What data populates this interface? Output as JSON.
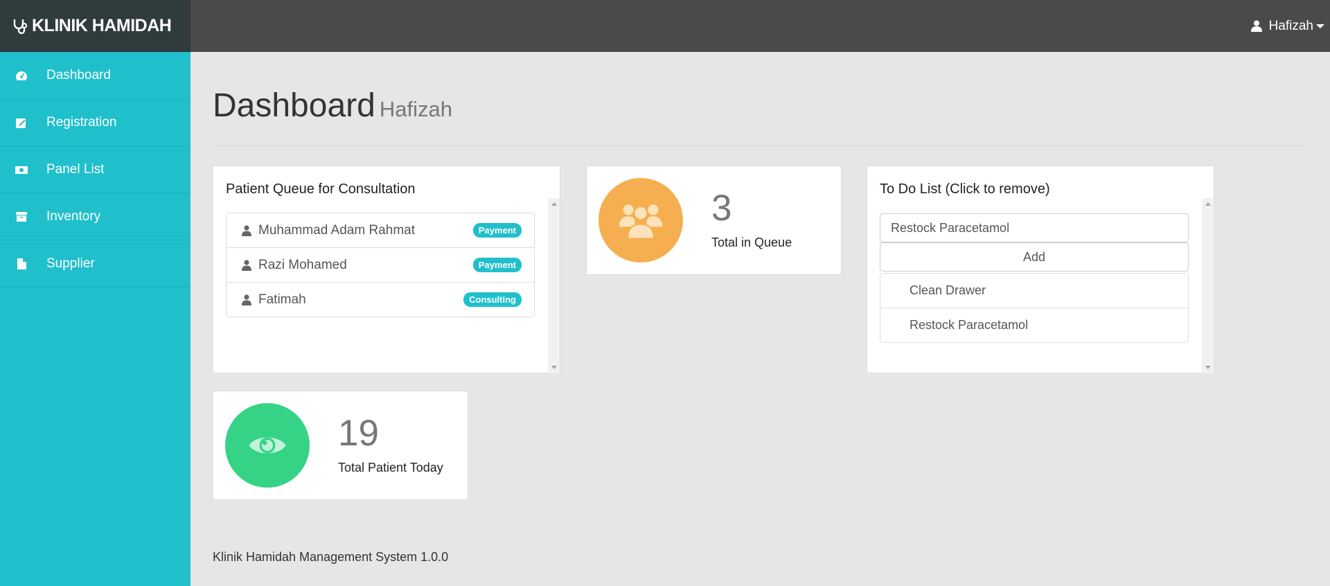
{
  "brand": {
    "name": "KLINIK HAMIDAH",
    "icon": "stethoscope-icon"
  },
  "user_menu": {
    "name": "Hafizah",
    "icon": "user-icon"
  },
  "sidebar": {
    "items": [
      {
        "label": "Dashboard",
        "icon": "dashboard-icon"
      },
      {
        "label": "Registration",
        "icon": "edit-icon"
      },
      {
        "label": "Panel List",
        "icon": "money-icon"
      },
      {
        "label": "Inventory",
        "icon": "archive-icon"
      },
      {
        "label": "Supplier",
        "icon": "file-icon"
      }
    ]
  },
  "page": {
    "title": "Dashboard",
    "subtitle": "Hafizah"
  },
  "queue": {
    "title": "Patient Queue for Consultation",
    "patients": [
      {
        "name": "Muhammad Adam Rahmat",
        "status": "Payment"
      },
      {
        "name": "Razi Mohamed",
        "status": "Payment"
      },
      {
        "name": "Fatimah",
        "status": "Consulting"
      }
    ]
  },
  "queue_stat": {
    "value": "3",
    "label": "Total in Queue",
    "color": "#f5af50",
    "icon": "users-icon"
  },
  "today_stat": {
    "value": "19",
    "label": "Total Patient Today",
    "color": "#34d386",
    "icon": "eye-icon"
  },
  "todo": {
    "title": "To Do List (Click to remove)",
    "input_value": "Restock Paracetamol",
    "add_label": "Add",
    "items": [
      "Clean Drawer",
      "Restock Paracetamol"
    ]
  },
  "footer": {
    "text": "Klinik Hamidah Management System 1.0.0"
  },
  "colors": {
    "sidebar": "#20bfcc",
    "topbar": "#4a4a4a",
    "brand_bg": "#2f3b3d",
    "badge": "#20bfcc"
  }
}
